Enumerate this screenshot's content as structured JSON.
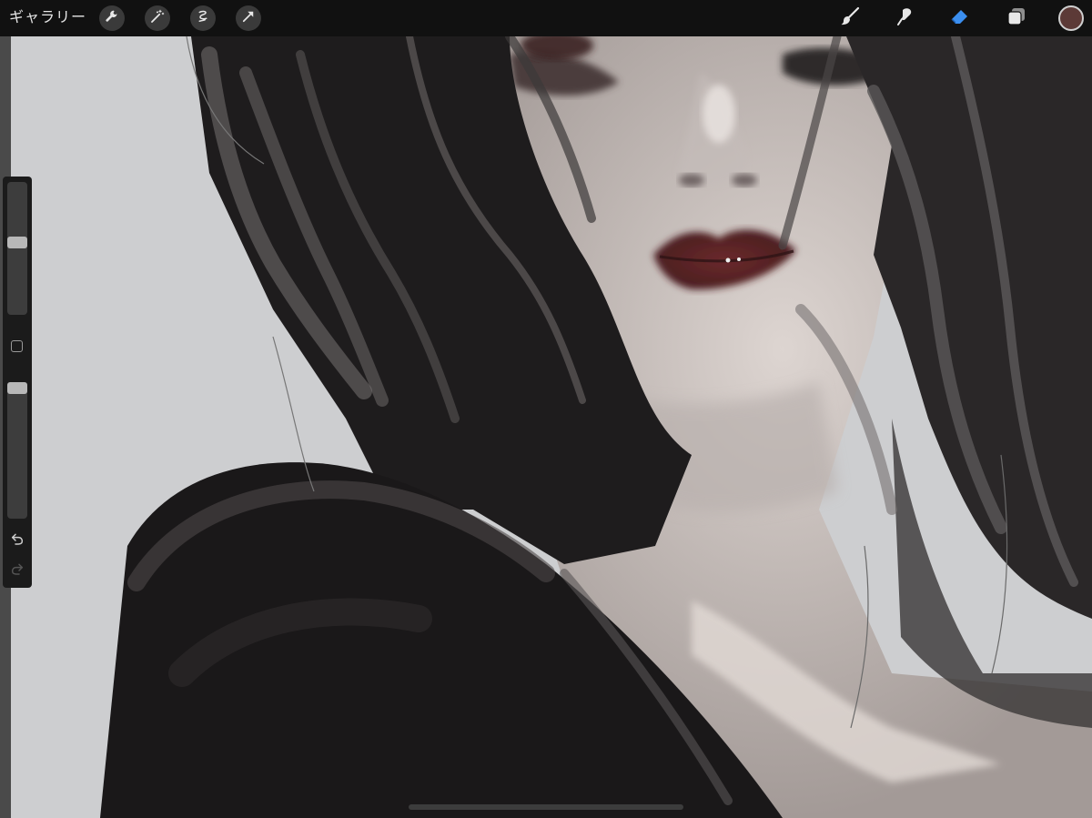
{
  "toolbar": {
    "gallery_label": "ギャラリー",
    "left_tools": [
      "wrench-icon",
      "magic-wand-icon",
      "selection-icon",
      "transform-arrow-icon"
    ],
    "right_tools": [
      "brush-icon",
      "smudge-icon",
      "eraser-icon",
      "layers-icon"
    ],
    "active_tool": "eraser",
    "active_tool_color": "#3b8ff0",
    "current_color": "#5c3a37"
  },
  "sidebar": {
    "brush_size_level": 0.45,
    "opacity_level": 0.0,
    "buttons": [
      "modify-square-icon",
      "undo-icon",
      "redo-icon"
    ]
  },
  "canvas": {
    "background_color": "#cdced0",
    "dominant_palette": [
      "#1d1b1c",
      "#5a5858",
      "#a8a09d",
      "#d6cdc8",
      "#5b2426"
    ]
  }
}
